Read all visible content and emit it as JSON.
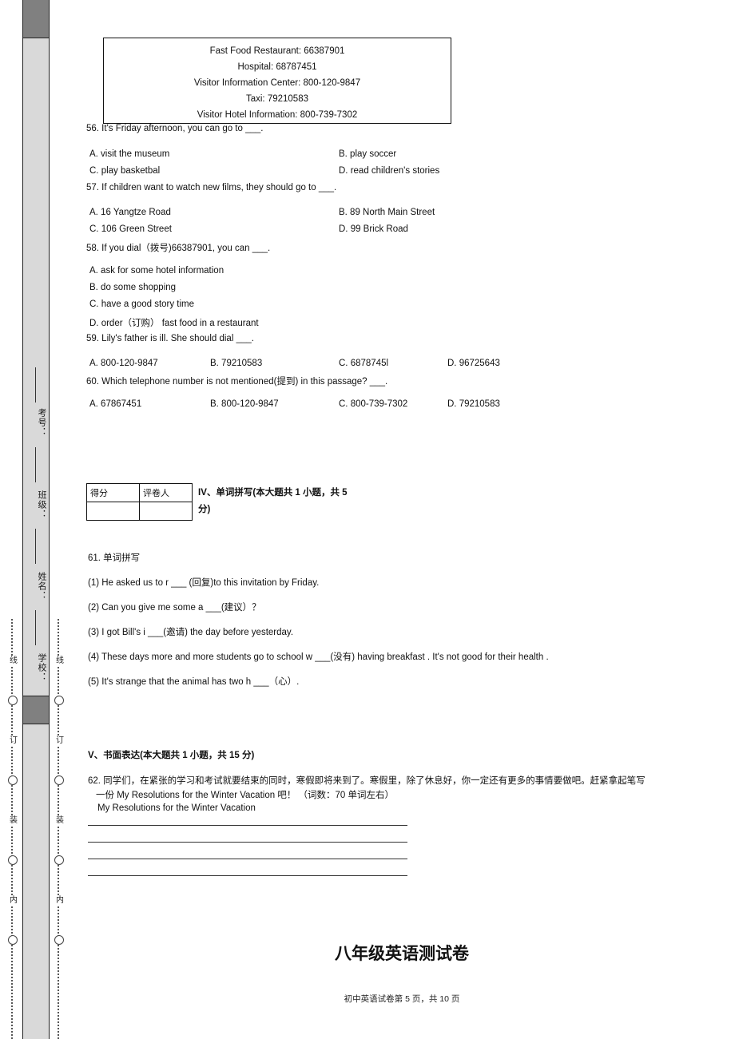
{
  "page": {
    "title": "八年级英语测试卷",
    "footer": "初中英语试卷第 5 页，共 10 页"
  },
  "sidebar": {
    "labels": [
      {
        "text": "考号："
      },
      {
        "text": "班级："
      },
      {
        "text": "姓名："
      },
      {
        "text": "学校："
      }
    ],
    "cut_glyphs": [
      "线",
      "订",
      "装",
      "内"
    ]
  },
  "info_box": {
    "lines": [
      "Fast Food Restaurant: 66387901",
      "Hospital: 68787451",
      "Visitor Information Center: 800-120-9847",
      "Taxi: 79210583",
      "Visitor Hotel Information: 800-739-7302"
    ]
  },
  "questions": [
    {
      "stem": "56. It's Friday afternoon, you can go to  ___.",
      "options": [
        "A.  visit the museum",
        "B.  play soccer",
        "C.  play basketbal",
        "D.  read children's stories"
      ]
    },
    {
      "stem": "57. If children want to watch new films, they should go to  ___.",
      "options": [
        "A.  16 Yangtze Road",
        "B.  89 North Main Street",
        "C.  106 Green Street",
        "D.  99 Brick Road"
      ]
    },
    {
      "stem": "58. If you dial（拨号)66387901, you can  ___.",
      "options": [
        "A.  ask for some hotel information",
        "B.  do some shopping",
        "C.  have a good story time",
        "D.  order（订购）  fast food in a restaurant"
      ]
    },
    {
      "stem": "59. Lily's father is ill. She should dial  ___.",
      "options": [
        "A.  800-120-9847",
        "B.  79210583",
        "C.  6878745l",
        "D.  96725643"
      ]
    },
    {
      "stem": "60.  Which telephone number is not mentioned(提到) in this passage?  ___.",
      "options": [
        "A.  67867451",
        "B.  800-120-9847",
        "C.  800-739-7302",
        "D.  79210583"
      ]
    }
  ],
  "score_table": {
    "headers": [
      "得分",
      "评卷人"
    ],
    "values": [
      "",
      ""
    ]
  },
  "section_iv": {
    "heading": "IV、单词拼写(本大题共 1 小题，共 5 分)",
    "question_label": "61.  单词拼写",
    "items": [
      "(1) He asked us to r ___ (回复)to this invitation by Friday.",
      "(2) Can you give me some a ___(建议）？",
      "(3) I got Bill's i ___(邀请) the day before yesterday.",
      "(4) These days more and more students go to school w ___(没有) having breakfast . It's not good for their health .",
      "(5) It's strange that the animal has two h ___（心）."
    ]
  },
  "section_v": {
    "heading": "V、书面表达(本大题共 1 小题，共 15 分)",
    "prompt_line1": "62.  同学们，在紧张的学习和考试就要结束的同时，寒假即将来到了。寒假里，除了休息好，你一定还有更多的事情要做吧。赶紧拿起笔写",
    "prompt_line2": "一份 My Resolutions for the Winter Vacation  吧！ （词数：70 单词左右）",
    "essay_title": "My Resolutions for the Winter Vacation",
    "answer_lines": [
      "",
      "",
      "",
      ""
    ]
  }
}
